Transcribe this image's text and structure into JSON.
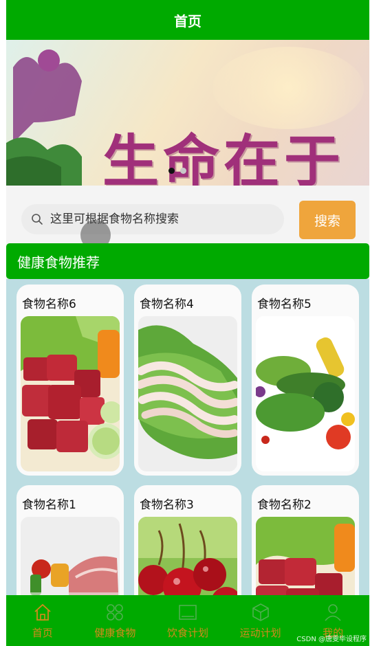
{
  "header": {
    "title": "首页"
  },
  "banner": {
    "slogan": "生命在于"
  },
  "carousel": {
    "total": 2,
    "active": 1
  },
  "search": {
    "placeholder": "这里可根据食物名称搜索",
    "button_label": "搜索"
  },
  "section": {
    "title": "健康食物推荐"
  },
  "foods": [
    {
      "name": "食物名称6",
      "photo": "meat-cubes"
    },
    {
      "name": "食物名称4",
      "photo": "tripe-on-lettuce"
    },
    {
      "name": "食物名称5",
      "photo": "vegetable-assortment"
    },
    {
      "name": "食物名称1",
      "photo": "meat-slab"
    },
    {
      "name": "食物名称3",
      "photo": "cherries"
    },
    {
      "name": "食物名称2",
      "photo": "meat-cubes"
    }
  ],
  "nav": [
    {
      "label": "首页",
      "icon": "home-icon"
    },
    {
      "label": "健康食物",
      "icon": "grid-icon"
    },
    {
      "label": "饮食计划",
      "icon": "image-icon"
    },
    {
      "label": "运动计划",
      "icon": "cube-icon"
    },
    {
      "label": "我的",
      "icon": "user-icon"
    }
  ],
  "watermark": "CSDN @唐雯毕设程序",
  "colors": {
    "primary": "#00aa00",
    "accent": "#efa53c",
    "nav_label": "#d48a1c",
    "grid_bg": "#bcdde2"
  }
}
